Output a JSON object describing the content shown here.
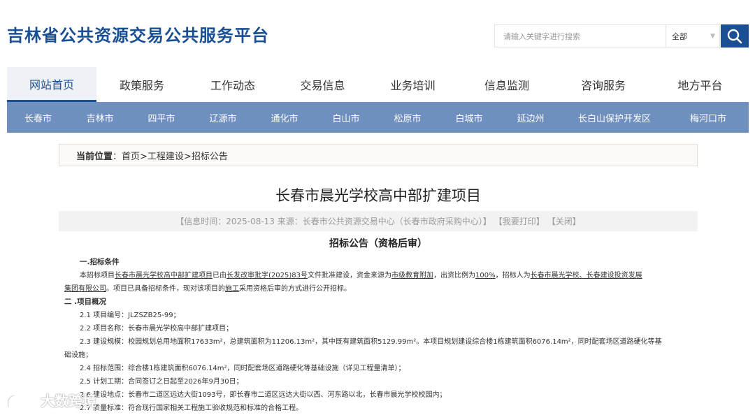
{
  "header": {
    "site_title": "吉林省公共资源交易公共服务平台",
    "search_placeholder": "请输入关键字进行搜索",
    "search_scope": "全部",
    "search_icon": "search-icon",
    "brand_color": "#1b4f93"
  },
  "main_nav": {
    "items": [
      {
        "label": "网站首页",
        "active": true
      },
      {
        "label": "政策服务"
      },
      {
        "label": "工作动态"
      },
      {
        "label": "交易信息"
      },
      {
        "label": "业务培训"
      },
      {
        "label": "信息监测"
      },
      {
        "label": "咨询服务"
      },
      {
        "label": "地方平台"
      }
    ]
  },
  "city_bar": {
    "color": "#6f8fbf",
    "items": [
      "长春市",
      "吉林市",
      "四平市",
      "辽源市",
      "通化市",
      "白山市",
      "松原市",
      "白城市",
      "延边州",
      "长白山保护开发区",
      "梅河口市"
    ]
  },
  "breadcrumb": {
    "label": "当前位置",
    "colon": "：",
    "path": "首页>工程建设>招标公告"
  },
  "article": {
    "title": "长春市晨光学校高中部扩建项目",
    "meta": {
      "info": "【信息时间：2025-08-13 来源：长春市公共资源交易中心（长春市政府采购中心）】",
      "print": "【我要打印】",
      "close": "【关闭】"
    },
    "subtitle": "招标公告（资格后审）",
    "sec1_heading": "一.招标条件",
    "sec1_p1_a": "本招标项目",
    "sec1_p1_u1": "长春市晨光学校高中部扩建项目",
    "sec1_p1_b": "已由",
    "sec1_p1_u2": "长发改审批字(2025)83号",
    "sec1_p1_c": "文件批准建设，资金来源为",
    "sec1_p1_u3": "市级教育附加",
    "sec1_p1_d": "，出资比例为",
    "sec1_p1_u4": "100%",
    "sec1_p1_e": "，招标人为",
    "sec1_p1_u5": "长春市晨光学校、长春建设投资发展",
    "sec1_p1_u6": "集团有限公司",
    "sec1_p1_f": "。项目已具备招标条件，现对该项目的",
    "sec1_p1_u7": "施工",
    "sec1_p1_g": "采用资格后审的方式进行公开招标。",
    "sec2_heading": "二 .项目概况",
    "item_2_1": "2.1 项目编号：JLZSZB25-99；",
    "item_2_2": "2.2 项目名称：长春市晨光学校高中部扩建项目；",
    "item_2_3_a": "2.3 建设规模：校园规划总用地面积17633m²，总建筑面积为11206.13m²，其中既有建筑面积5129.99m²。本项目规划建设综合楼1栋建筑面积6076.14m²，同时配套场区道路硬化等基",
    "item_2_3_b": "础设施；",
    "item_2_4": "2.4 招标范围：综合楼1栋建筑面积6076.14m²，同时配套场区道路硬化等基础设施（详见工程量清单）；",
    "item_2_5": "2.5 计划工期：合同签订之日起至2026年9月30日；",
    "item_2_6": "2.6 建设地点：长春市二道区远达大街1093号，即长春市二道区远达大街以西、河东路以北，长春市晨光学校校园内；",
    "item_2_7": "2.7 质量标准：符合现行国家相关工程施工验收规范和标准的合格工程。"
  },
  "watermark": {
    "text": "大数跨境",
    "icon": "logo-icon"
  }
}
